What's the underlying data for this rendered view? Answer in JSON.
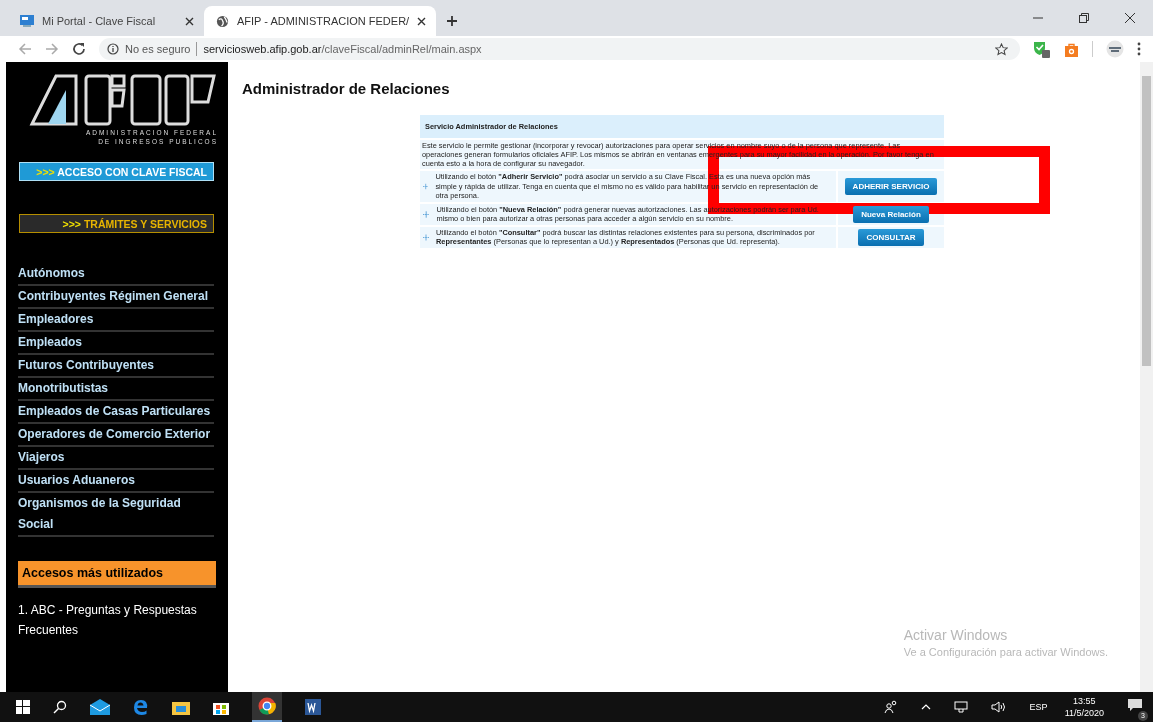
{
  "browser": {
    "tabs": [
      {
        "title": "Mi Portal - Clave Fiscal",
        "selected": false
      },
      {
        "title": "AFIP - ADMINISTRACION FEDER/",
        "selected": true
      }
    ],
    "address": {
      "security_label": "No es seguro",
      "url_host": "serviciosweb.afip.gob.ar",
      "url_path": "/claveFiscal/adminRel/main.aspx"
    }
  },
  "sidebar": {
    "logo_caption": [
      "ADMINISTRACION FEDERAL",
      "DE INGRESOS PUBLICOS"
    ],
    "buttons": [
      {
        "kind": "primary",
        "prefix": ">>>",
        "label": "ACCESO CON CLAVE FISCAL"
      },
      {
        "kind": "secondary",
        "prefix": ">>>",
        "label": "TRÁMITES Y SERVICIOS"
      }
    ],
    "menu": [
      "Autónomos",
      "Contribuyentes Régimen General",
      "Empleadores",
      "Empleados",
      "Futuros Contribuyentes",
      "Monotributistas",
      "Empleados de Casas Particulares",
      "Operadores de Comercio Exterior",
      "Viajeros",
      "Usuarios Aduaneros",
      "Organismos de la Seguridad Social"
    ],
    "accesos": {
      "title": "Accesos más utilizados",
      "items": [
        "1. ABC - Preguntas y Respuestas Frecuentes"
      ]
    }
  },
  "main": {
    "title": "Administrador de Relaciones",
    "panel": {
      "header": "Servicio Administrador de Relaciones",
      "intro": "Este servicio le permite gestionar (incorporar y revocar) autorizaciones para operar servicios en nombre suyo o de la persona que represente. Las operaciones generan formularios oficiales AFIP. Los mismos se abrirán en ventanas emergentes para su mayor facilidad en la operación. Por favor tenga en cuenta esto a la hora de configurar su navegador.",
      "rows": [
        {
          "text": "Utilizando el botón **\"Adherir Servicio\"** podrá asociar un servicio a su Clave Fiscal. Esta es una nueva opción más simple y rápida de utilizar. Tenga en cuenta que el mismo no es válido para habilitar un servicio en representación de otra persona.",
          "button": "ADHERIR SERVICIO"
        },
        {
          "text": "Utilizando el botón **\"Nueva Relación\"** podrá generar nuevas autorizaciones. Las autorizaciones podrán ser para Ud. mismo o bien para autorizar a otras personas para acceder a algún servicio en su nombre.",
          "button": "Nueva Relación"
        },
        {
          "text": "Utilizando el botón **\"Consultar\"** podrá buscar las distintas relaciones existentes para su persona, discriminados por **Representantes** (Personas que lo representan a Ud.) y **Representados** (Personas que Ud. representa).",
          "button": "CONSULTAR"
        }
      ]
    }
  },
  "annotations": [
    {
      "kind": "rectangle"
    }
  ],
  "activation_notice": {
    "title": "Activar Windows",
    "message": "Ve a Configuración para activar Windows."
  },
  "taskbar": {
    "language": "ESP",
    "time": "13:55",
    "date": "11/5/2020",
    "notifications": "3"
  }
}
